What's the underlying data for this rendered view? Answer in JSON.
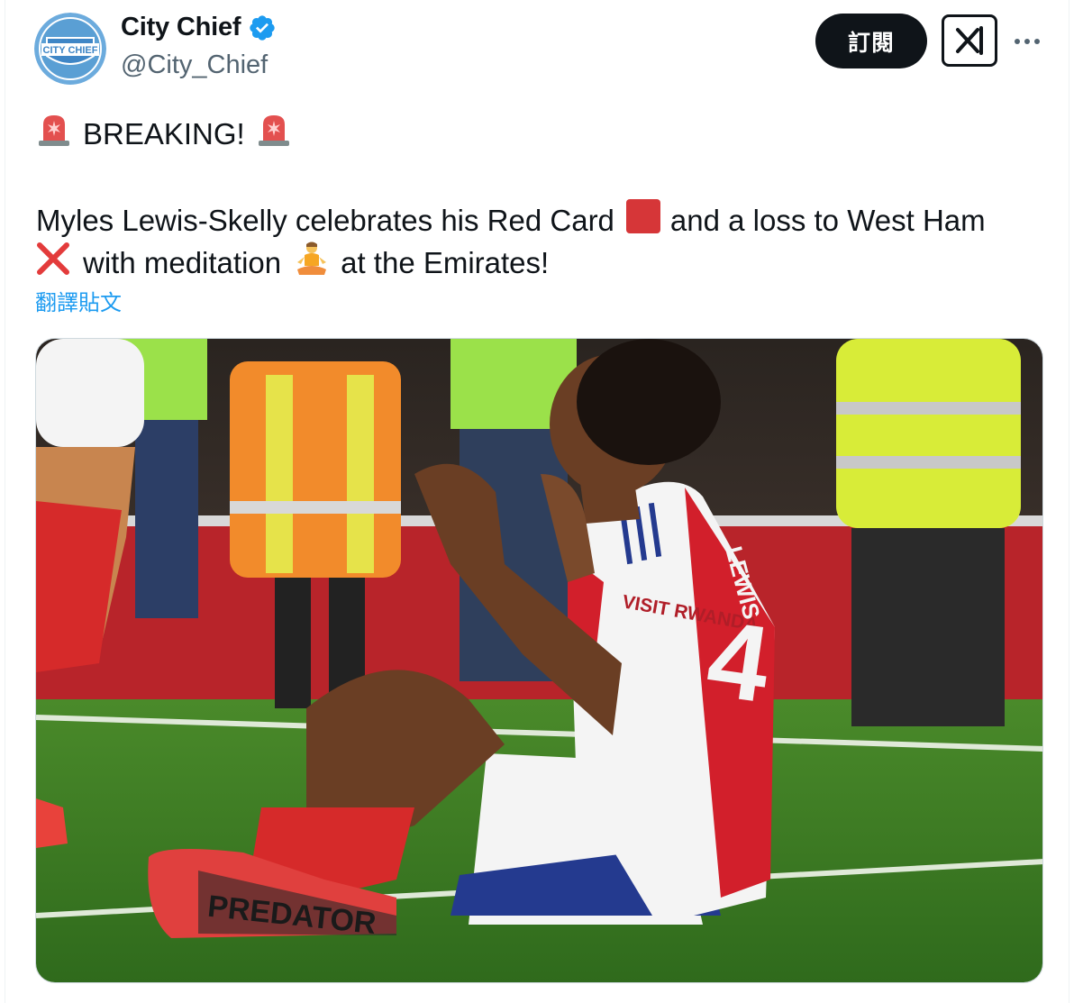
{
  "author": {
    "display_name": "City Chief",
    "handle": "@City_Chief",
    "avatar_text": "CITY CHIEF",
    "verified": true
  },
  "actions": {
    "subscribe_label": "訂閱",
    "grok_icon": "grok-icon",
    "more_icon": "more-horizontal-icon"
  },
  "tweet": {
    "line1": "BREAKING!",
    "line2_a": "Myles Lewis-Skelly celebrates his Red Card",
    "line2_b": "and a loss to West Ham",
    "line3_a": "with meditation",
    "line3_b": "at the Emirates!",
    "emojis": [
      "police-light-emoji",
      "red-square-emoji",
      "cross-mark-emoji",
      "meditation-emoji"
    ]
  },
  "translate_label": "翻譯貼文",
  "media": {
    "alt_icon": "photo",
    "shirt_sponsor": "VISIT RWANDA",
    "boot_text": "PREDATOR",
    "shirt_name": "LEWIS",
    "shirt_number": "4"
  },
  "colors": {
    "accent": "#1d9bf0",
    "text": "#0f1419",
    "secondary": "#536471",
    "verified": "#1d9bf0"
  }
}
